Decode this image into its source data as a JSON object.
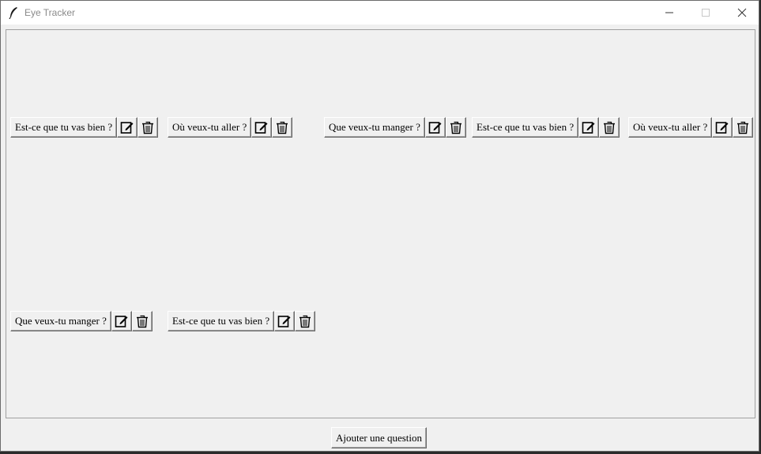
{
  "window": {
    "title": "Eye Tracker"
  },
  "questions": [
    {
      "label": "Est-ce que tu vas bien ?"
    },
    {
      "label": "Où veux-tu aller ?"
    },
    {
      "label": "Que veux-tu manger ?"
    },
    {
      "label": "Est-ce que tu vas bien ?"
    },
    {
      "label": "Où veux-tu aller ?"
    },
    {
      "label": "Que veux-tu manger ?"
    },
    {
      "label": "Est-ce que tu vas bien ?"
    }
  ],
  "icons": {
    "edit": "edit-icon",
    "delete": "trash-icon"
  },
  "footer": {
    "add_label": "Ajouter une question"
  }
}
